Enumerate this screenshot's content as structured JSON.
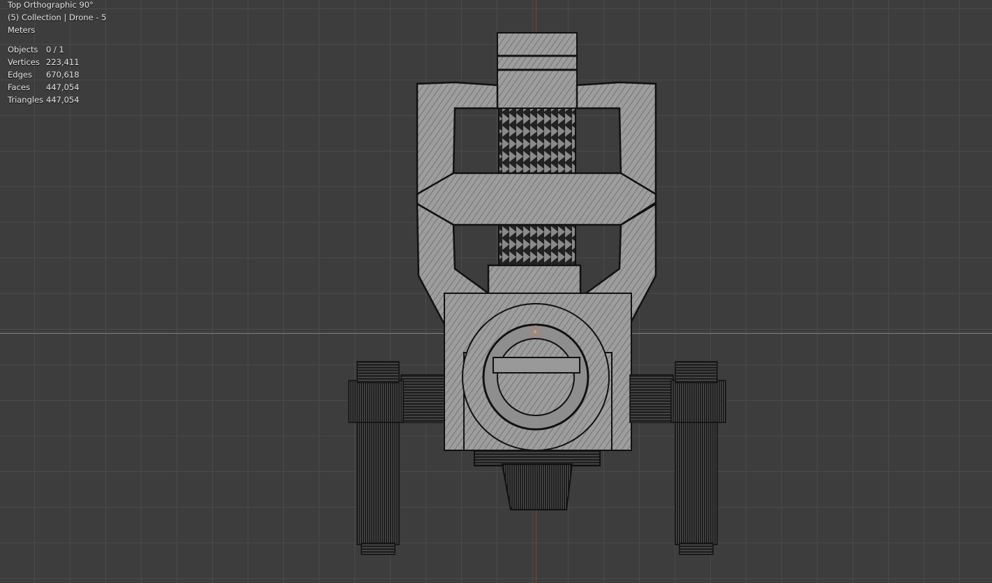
{
  "viewport": {
    "view_name": "Top Orthographic 90°",
    "collection": "(5) Collection | Drone - 5",
    "units": "Meters"
  },
  "statistics": {
    "objects": {
      "label": "Objects",
      "value": "0 / 1"
    },
    "vertices": {
      "label": "Vertices",
      "value": "223,411"
    },
    "edges": {
      "label": "Edges",
      "value": "670,618"
    },
    "faces": {
      "label": "Faces",
      "value": "447,054"
    },
    "triangles": {
      "label": "Triangles",
      "value": "447,054"
    }
  },
  "colors": {
    "background": "#3d3d3d",
    "grid": "#4a4a4a",
    "x_axis": "#6a9a3a",
    "y_axis": "#9a3a3a",
    "mesh_fill": "#9a9a9a",
    "mesh_wire": "#1a1a1a"
  }
}
